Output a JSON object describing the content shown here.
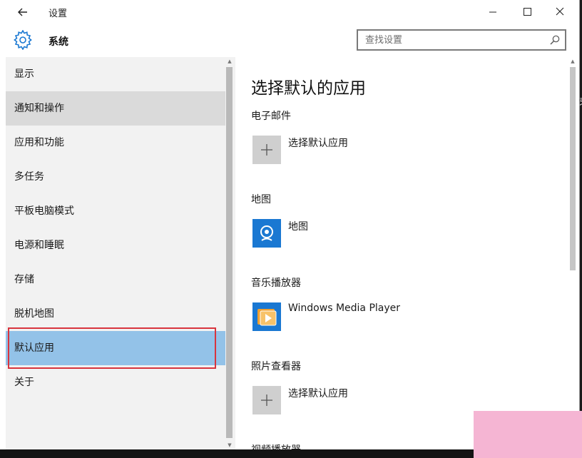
{
  "window": {
    "title": "设置",
    "controls": [
      "minimize",
      "maximize",
      "close"
    ]
  },
  "header": {
    "section_title": "系统",
    "search_placeholder": "查找设置"
  },
  "sidebar": {
    "items": [
      {
        "label": "显示",
        "state": "normal"
      },
      {
        "label": "通知和操作",
        "state": "hover"
      },
      {
        "label": "应用和功能",
        "state": "normal"
      },
      {
        "label": "多任务",
        "state": "normal"
      },
      {
        "label": "平板电脑模式",
        "state": "normal"
      },
      {
        "label": "电源和睡眠",
        "state": "normal"
      },
      {
        "label": "存储",
        "state": "normal"
      },
      {
        "label": "脱机地图",
        "state": "normal"
      },
      {
        "label": "默认应用",
        "state": "selected"
      },
      {
        "label": "关于",
        "state": "normal"
      }
    ]
  },
  "main": {
    "title": "选择默认的应用",
    "sections": [
      {
        "label": "电子邮件",
        "app_name": "选择默认应用",
        "icon": "plus-icon"
      },
      {
        "label": "地图",
        "app_name": "地图",
        "icon": "maps-icon"
      },
      {
        "label": "音乐播放器",
        "app_name": "Windows Media Player",
        "icon": "media-player-icon"
      },
      {
        "label": "照片查看器",
        "app_name": "选择默认应用",
        "icon": "plus-icon"
      },
      {
        "label": "视频播放器"
      }
    ]
  },
  "desktop_fragment": "牙",
  "colors": {
    "accent": "#1a78d2",
    "selected_bg": "#93c2e8",
    "hover_bg": "#dadada",
    "sidebar_bg": "#f2f2f2",
    "annotation_red": "#d8343d",
    "tile_placeholder": "#cfcfcf"
  }
}
